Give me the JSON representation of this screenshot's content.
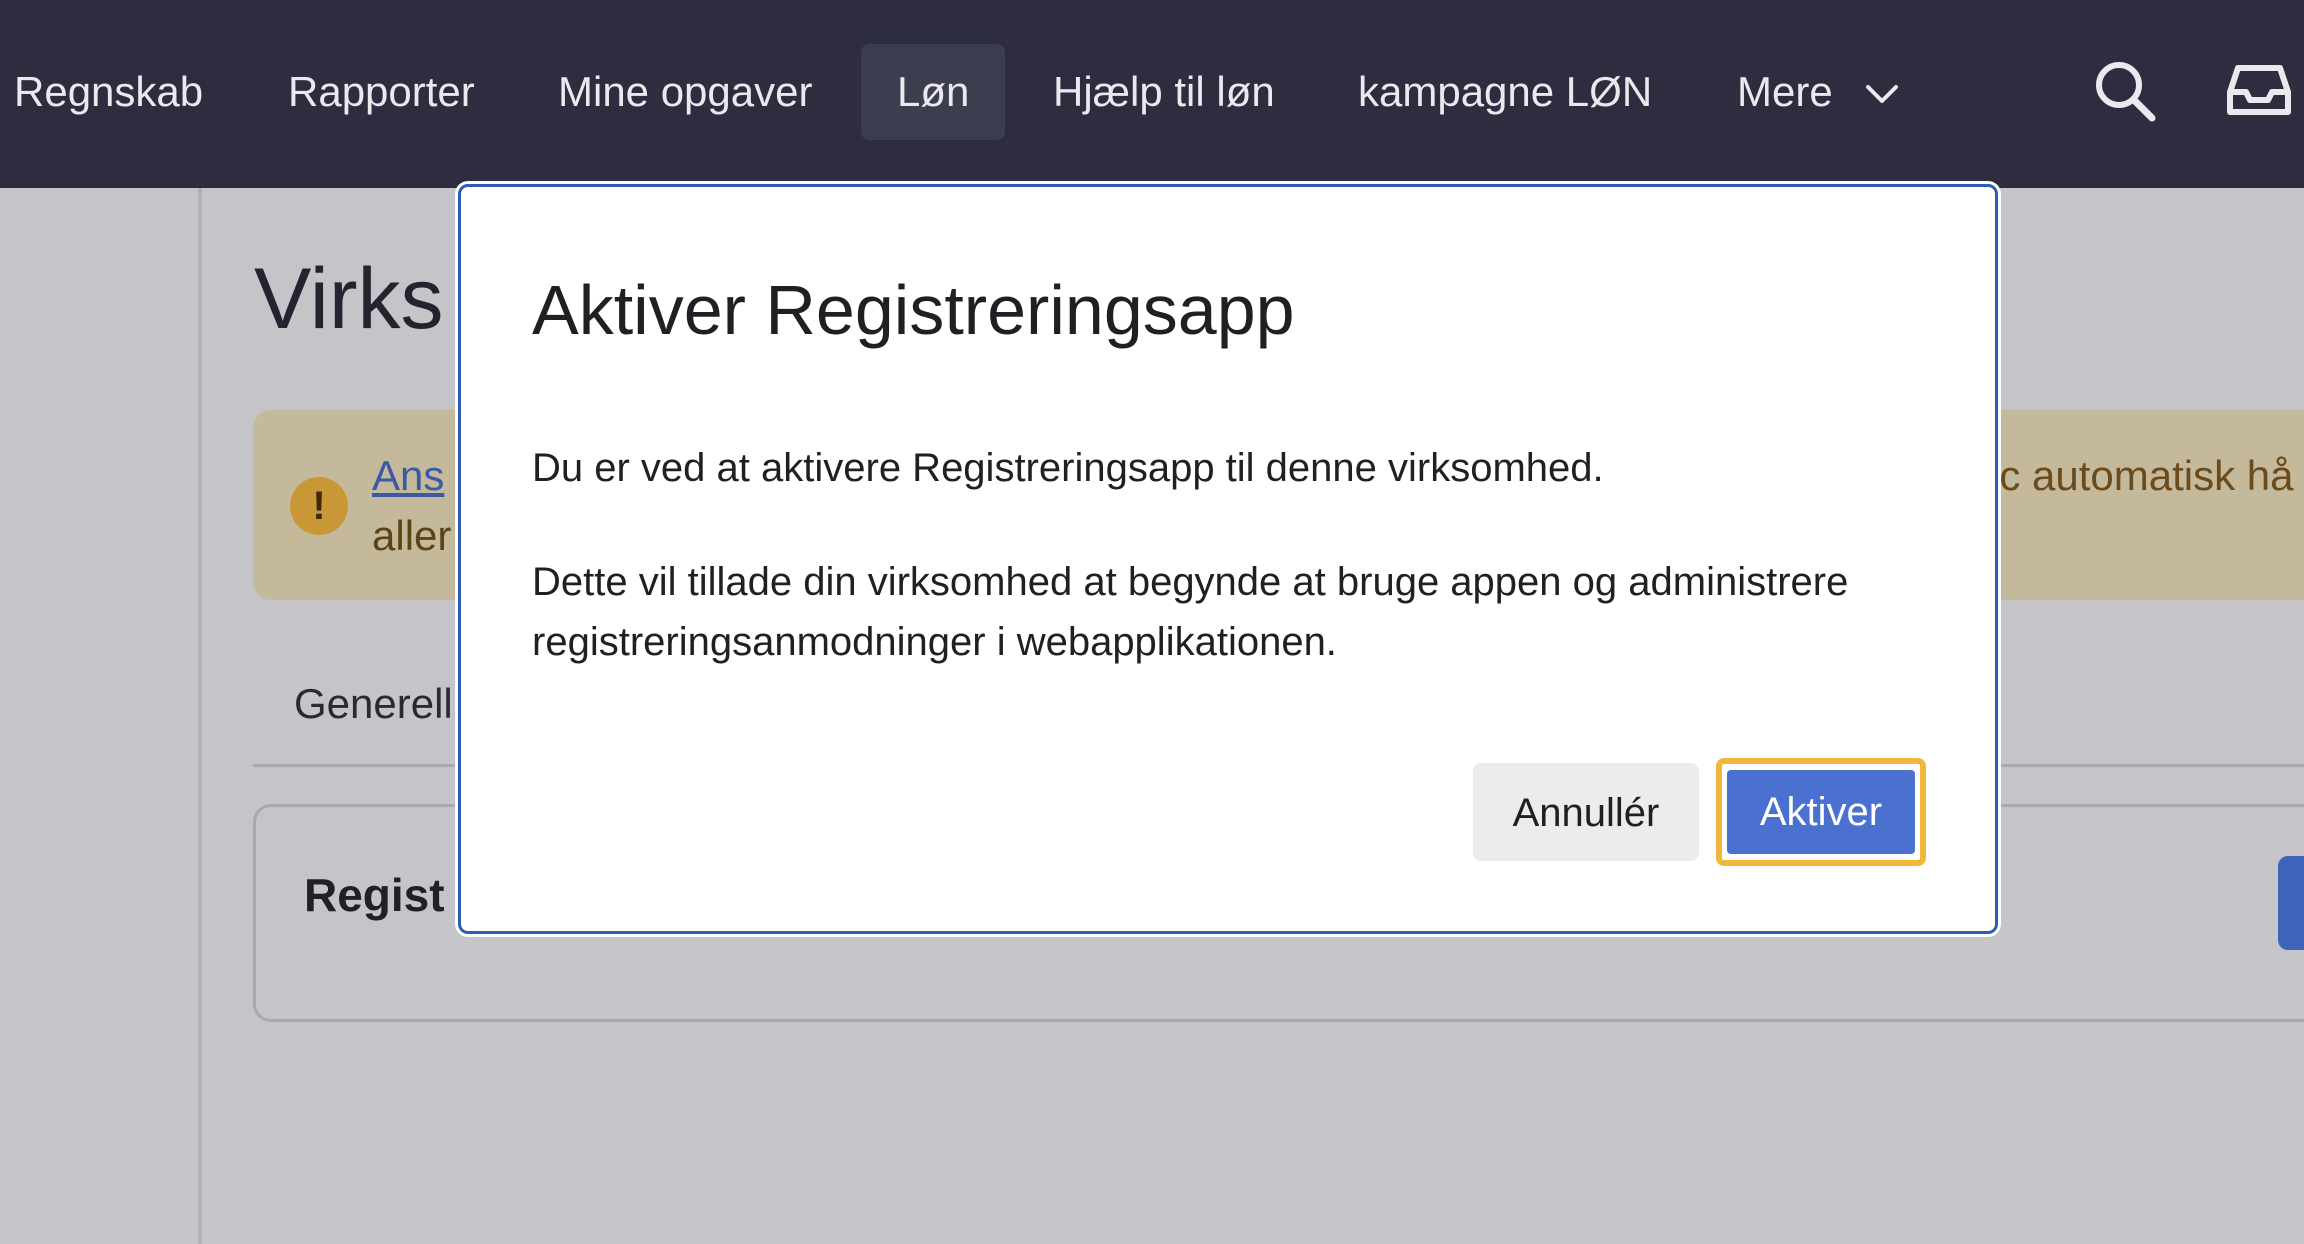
{
  "nav": {
    "items": [
      "Regnskab",
      "Rapporter",
      "Mine opgaver",
      "Løn",
      "Hjælp til løn",
      "kampagne LØN",
      "Mere"
    ],
    "active": "Løn",
    "icons": [
      "chevron-down-icon",
      "search-icon",
      "inbox-icon"
    ]
  },
  "page": {
    "title": "Virks",
    "alert": {
      "link_text": "Ans",
      "line2": "aller",
      "right_text": "ic automatisk hå",
      "icon": "!"
    },
    "tab": "Generell",
    "card_title": "Regist"
  },
  "modal": {
    "title": "Aktiver Registreringsapp",
    "p1": "Du er ved at aktivere Registreringsapp til denne virksomhed.",
    "p2": "Dette vil tillade din virksomhed at begynde at bruge appen og administrere registreringsanmodninger i webapplikationen.",
    "cancel_label": "Annullér",
    "activate_label": "Aktiver"
  },
  "colors": {
    "nav_bg": "#2d2d3f",
    "overlay": "#c4c4c9",
    "primary": "#4a71d0",
    "focus": "#f0b73b",
    "warning_bg": "#c4b99a"
  }
}
